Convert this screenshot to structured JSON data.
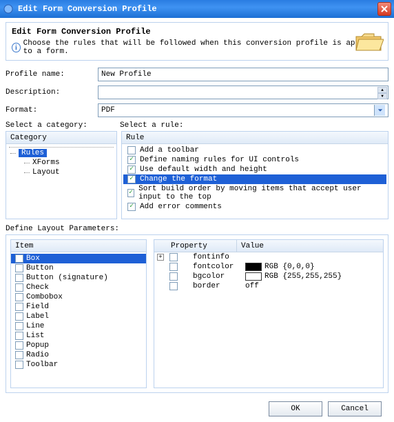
{
  "title": "Edit Form Conversion Profile",
  "header": {
    "heading": "Edit Form Conversion Profile",
    "info": "Choose the rules that will be followed when this conversion profile is applied to a form."
  },
  "fields": {
    "profile_name_label": "Profile name:",
    "profile_name_value": "New Profile",
    "description_label": "Description:",
    "description_value": "",
    "format_label": "Format:",
    "format_value": "PDF"
  },
  "select_category_label": "Select a category:",
  "select_rule_label": "Select a rule:",
  "category_header": "Category",
  "categories": [
    {
      "label": "Rules",
      "selected": true
    },
    {
      "label": "XForms",
      "selected": false
    },
    {
      "label": "Layout",
      "selected": false
    }
  ],
  "rule_header": "Rule",
  "rules": [
    {
      "label": "Add a toolbar",
      "checked": false,
      "selected": false
    },
    {
      "label": "Define naming rules for UI controls",
      "checked": true,
      "selected": false
    },
    {
      "label": "Use default width and height",
      "checked": true,
      "selected": false
    },
    {
      "label": "Change the format",
      "checked": true,
      "selected": true
    },
    {
      "label": "Sort build order by moving items that accept user input to the top",
      "checked": true,
      "selected": false
    },
    {
      "label": "Add error comments",
      "checked": true,
      "selected": false
    }
  ],
  "define_layout_label": "Define Layout Parameters:",
  "item_header": "Item",
  "items": [
    {
      "label": "Box",
      "selected": true
    },
    {
      "label": "Button",
      "selected": false
    },
    {
      "label": "Button (signature)",
      "selected": false
    },
    {
      "label": "Check",
      "selected": false
    },
    {
      "label": "Combobox",
      "selected": false
    },
    {
      "label": "Field",
      "selected": false
    },
    {
      "label": "Label",
      "selected": false
    },
    {
      "label": "Line",
      "selected": false
    },
    {
      "label": "List",
      "selected": false
    },
    {
      "label": "Popup",
      "selected": false
    },
    {
      "label": "Radio",
      "selected": false
    },
    {
      "label": "Toolbar",
      "selected": false
    }
  ],
  "property_header": "Property",
  "value_header": "Value",
  "properties": [
    {
      "name": "fontinfo",
      "value": "",
      "swatch": null
    },
    {
      "name": "fontcolor",
      "value": "RGB {0,0,0}",
      "swatch": "#000000"
    },
    {
      "name": "bgcolor",
      "value": "RGB {255,255,255}",
      "swatch": "#ffffff"
    },
    {
      "name": "border",
      "value": "off",
      "swatch": null
    }
  ],
  "buttons": {
    "ok": "OK",
    "cancel": "Cancel"
  }
}
